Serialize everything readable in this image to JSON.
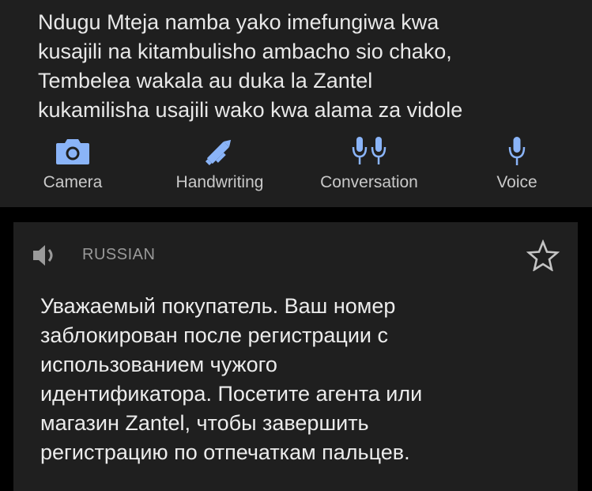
{
  "source": {
    "text": "Ndugu Mteja namba yako imefungiwa kwa\nkusajili na kitambulisho ambacho sio chako,\nTembelea wakala au duka la Zantel\nkukamilisha usajili wako kwa alama za vidole"
  },
  "tools": [
    {
      "label": "Camera",
      "icon": "camera-icon"
    },
    {
      "label": "Handwriting",
      "icon": "pen-icon"
    },
    {
      "label": "Conversation",
      "icon": "two-microphones-icon"
    },
    {
      "label": "Voice",
      "icon": "microphone-icon"
    }
  ],
  "result": {
    "language": "RUSSIAN",
    "text": "Уважаемый покупатель. Ваш номер\nзаблокирован после регистрации с\nиспользованием чужого\nидентификатора. Посетите агента или\nмагазин Zantel, чтобы завершить\nрегистрацию по отпечаткам пальцев."
  },
  "colors": {
    "accent": "#8ab4f8",
    "panel_background": "#1f1f1f",
    "page_background": "#000000"
  }
}
